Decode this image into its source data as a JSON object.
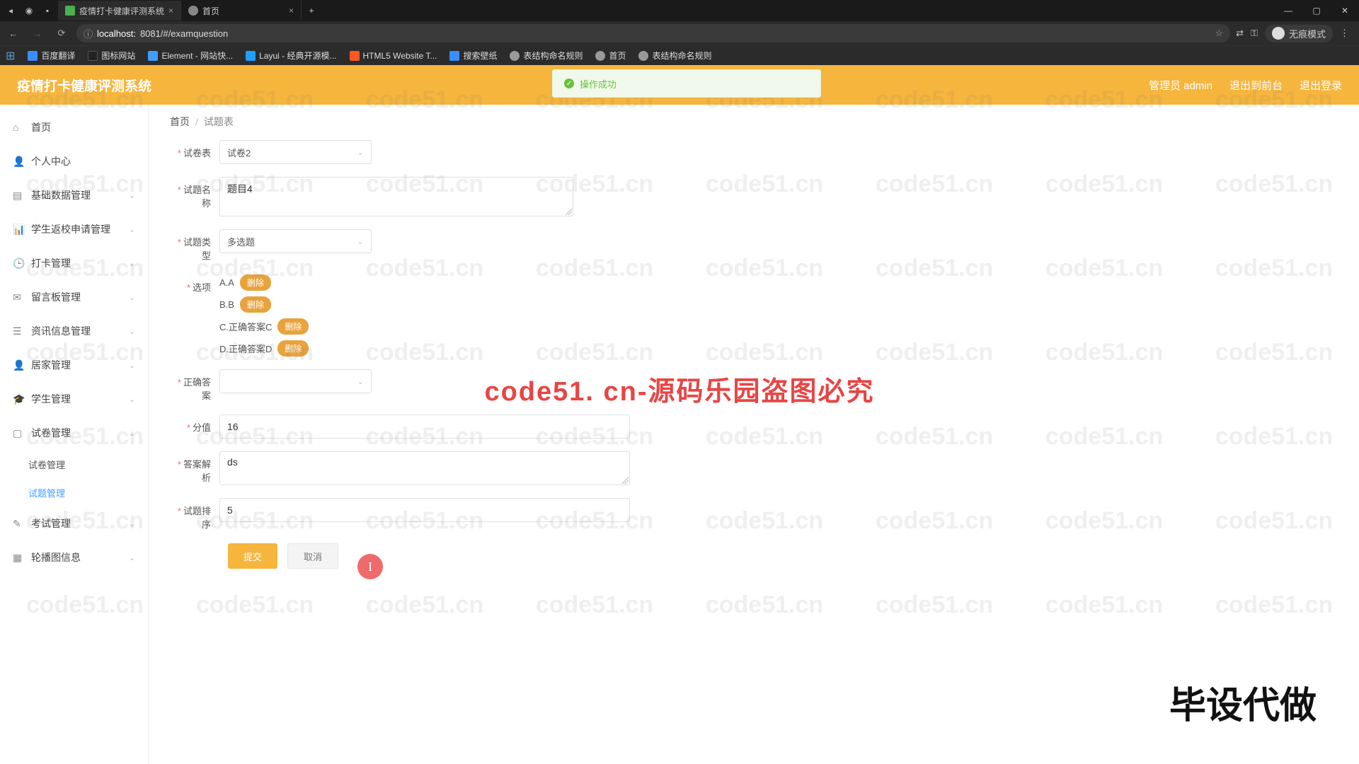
{
  "browser": {
    "tabs": [
      {
        "title": "疫情打卡健康评测系统",
        "active": true,
        "icon_color": "#4caf50"
      },
      {
        "title": "首页",
        "active": false,
        "icon_color": "#888"
      }
    ],
    "url_prefix": "localhost:",
    "url_host": "8081/#/examquestion",
    "incognito": "无痕模式",
    "bookmarks": [
      {
        "label": "百度翻译",
        "color": "#3b8cff"
      },
      {
        "label": "图标网站",
        "color": "#fff"
      },
      {
        "label": "Element - 网站快...",
        "color": "#409eff"
      },
      {
        "label": "Layui - 经典开源模...",
        "color": "#1e9fff"
      },
      {
        "label": "HTML5 Website T...",
        "color": "#ff5722"
      },
      {
        "label": "搜索壁纸",
        "color": "#3b8cff"
      },
      {
        "label": "表结构命名规则",
        "color": "#999"
      },
      {
        "label": "首页",
        "color": "#999"
      },
      {
        "label": "表结构命名规则",
        "color": "#999"
      }
    ]
  },
  "header": {
    "title": "疫情打卡健康评测系统",
    "user": "管理员 admin",
    "logout_front": "退出到前台",
    "logout": "退出登录"
  },
  "toast": {
    "msg": "操作成功"
  },
  "sidebar": {
    "items": [
      {
        "label": "首页",
        "ico": "⌂"
      },
      {
        "label": "个人中心",
        "ico": "👤"
      },
      {
        "label": "基础数据管理",
        "ico": "▤",
        "expand": true
      },
      {
        "label": "学生返校申请管理",
        "ico": "📊",
        "expand": true
      },
      {
        "label": "打卡管理",
        "ico": "🕒",
        "expand": true
      },
      {
        "label": "留言板管理",
        "ico": "✉",
        "expand": true
      },
      {
        "label": "资讯信息管理",
        "ico": "☰",
        "expand": true
      },
      {
        "label": "居家管理",
        "ico": "👤",
        "expand": true
      },
      {
        "label": "学生管理",
        "ico": "🎓",
        "expand": true
      },
      {
        "label": "试卷管理",
        "ico": "▢",
        "expand": true
      }
    ],
    "sub": [
      {
        "label": "试卷管理",
        "active": false
      },
      {
        "label": "试题管理",
        "active": true
      }
    ],
    "tail": [
      {
        "label": "考试管理",
        "ico": "✎",
        "expand": true
      },
      {
        "label": "轮播图信息",
        "ico": "▦",
        "expand": true
      }
    ]
  },
  "crumb": {
    "home": "首页",
    "current": "试题表"
  },
  "form": {
    "paper": {
      "label": "试卷表",
      "value": "试卷2"
    },
    "qname": {
      "label": "试题名称",
      "value": "题目4"
    },
    "qtype": {
      "label": "试题类型",
      "value": "多选题"
    },
    "options": {
      "label": "选项",
      "delete": "删除",
      "items": [
        "A.A",
        "B.B",
        "C.正确答案C",
        "D.正确答案D"
      ]
    },
    "correct": {
      "label": "正确答案",
      "value": ""
    },
    "score": {
      "label": "分值",
      "value": "16"
    },
    "analysis": {
      "label": "答案解析",
      "value": "ds"
    },
    "order": {
      "label": "试题排序",
      "value": "5"
    },
    "submit": "提交",
    "cancel": "取消"
  },
  "watermark": {
    "text": "code51.cn",
    "center": "code51. cn-源码乐园盗图必究",
    "corner": "毕设代做"
  }
}
